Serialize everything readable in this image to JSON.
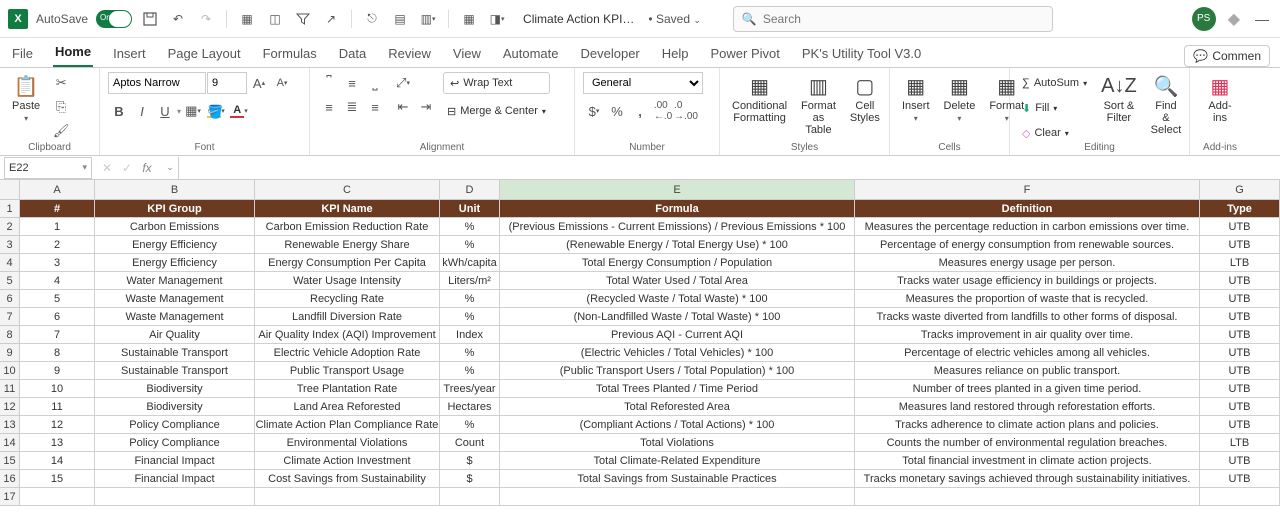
{
  "titlebar": {
    "autosave_label": "AutoSave",
    "autosave_on": "On",
    "filename": "Climate Action KPI…",
    "saved": "Saved",
    "search_placeholder": "Search",
    "avatar_initials": "PS"
  },
  "tabs": {
    "file": "File",
    "home": "Home",
    "insert": "Insert",
    "page_layout": "Page Layout",
    "formulas": "Formulas",
    "data": "Data",
    "review": "Review",
    "view": "View",
    "automate": "Automate",
    "developer": "Developer",
    "help": "Help",
    "power_pivot": "Power Pivot",
    "util": "PK's Utility Tool V3.0",
    "comments": "Commen"
  },
  "ribbon": {
    "clipboard": {
      "paste": "Paste",
      "label": "Clipboard"
    },
    "font": {
      "name": "Aptos Narrow",
      "size": "9",
      "label": "Font",
      "bold": "B",
      "italic": "I",
      "underline": "U",
      "font_letter": "A"
    },
    "alignment": {
      "wrap": "Wrap Text",
      "merge": "Merge & Center",
      "label": "Alignment"
    },
    "number": {
      "format": "General",
      "label": "Number"
    },
    "styles": {
      "cond": "Conditional Formatting",
      "fmt_table": "Format as Table",
      "cell_styles": "Cell Styles",
      "label": "Styles"
    },
    "cells": {
      "insert": "Insert",
      "delete": "Delete",
      "format": "Format",
      "label": "Cells"
    },
    "editing": {
      "autosum": "AutoSum",
      "fill": "Fill",
      "clear": "Clear",
      "sort": "Sort & Filter",
      "find": "Find & Select",
      "label": "Editing"
    },
    "addins": {
      "btn": "Add-ins",
      "label": "Add-ins"
    }
  },
  "formula_bar": {
    "name_box": "E22",
    "formula": ""
  },
  "columns": [
    "A",
    "B",
    "C",
    "D",
    "E",
    "F",
    "G"
  ],
  "header_row": [
    "#",
    "KPI Group",
    "KPI Name",
    "Unit",
    "Formula",
    "Definition",
    "Type"
  ],
  "rows": [
    [
      "1",
      "Carbon Emissions",
      "Carbon Emission Reduction Rate",
      "%",
      "(Previous Emissions - Current Emissions) / Previous Emissions * 100",
      "Measures the percentage reduction in carbon emissions over time.",
      "UTB"
    ],
    [
      "2",
      "Energy Efficiency",
      "Renewable Energy Share",
      "%",
      "(Renewable Energy / Total Energy Use) * 100",
      "Percentage of energy consumption from renewable sources.",
      "UTB"
    ],
    [
      "3",
      "Energy Efficiency",
      "Energy Consumption Per Capita",
      "kWh/capita",
      "Total Energy Consumption / Population",
      "Measures energy usage per person.",
      "LTB"
    ],
    [
      "4",
      "Water Management",
      "Water Usage Intensity",
      "Liters/m²",
      "Total Water Used / Total Area",
      "Tracks water usage efficiency in buildings or projects.",
      "UTB"
    ],
    [
      "5",
      "Waste Management",
      "Recycling Rate",
      "%",
      "(Recycled Waste / Total Waste) * 100",
      "Measures the proportion of waste that is recycled.",
      "UTB"
    ],
    [
      "6",
      "Waste Management",
      "Landfill Diversion Rate",
      "%",
      "(Non-Landfilled Waste / Total Waste) * 100",
      "Tracks waste diverted from landfills to other forms of disposal.",
      "UTB"
    ],
    [
      "7",
      "Air Quality",
      "Air Quality Index (AQI) Improvement",
      "Index",
      "Previous AQI - Current AQI",
      "Tracks improvement in air quality over time.",
      "UTB"
    ],
    [
      "8",
      "Sustainable Transport",
      "Electric Vehicle Adoption Rate",
      "%",
      "(Electric Vehicles / Total Vehicles) * 100",
      "Percentage of electric vehicles among all vehicles.",
      "UTB"
    ],
    [
      "9",
      "Sustainable Transport",
      "Public Transport Usage",
      "%",
      "(Public Transport Users / Total Population) * 100",
      "Measures reliance on public transport.",
      "UTB"
    ],
    [
      "10",
      "Biodiversity",
      "Tree Plantation Rate",
      "Trees/year",
      "Total Trees Planted / Time Period",
      "Number of trees planted in a given time period.",
      "UTB"
    ],
    [
      "11",
      "Biodiversity",
      "Land Area Reforested",
      "Hectares",
      "Total Reforested Area",
      "Measures land restored through reforestation efforts.",
      "UTB"
    ],
    [
      "12",
      "Policy Compliance",
      "Climate Action Plan Compliance Rate",
      "%",
      "(Compliant Actions / Total Actions) * 100",
      "Tracks adherence to climate action plans and policies.",
      "UTB"
    ],
    [
      "13",
      "Policy Compliance",
      "Environmental Violations",
      "Count",
      "Total Violations",
      "Counts the number of environmental regulation breaches.",
      "LTB"
    ],
    [
      "14",
      "Financial Impact",
      "Climate Action Investment",
      "$",
      "Total Climate-Related Expenditure",
      "Total financial investment in climate action projects.",
      "UTB"
    ],
    [
      "15",
      "Financial Impact",
      "Cost Savings from Sustainability",
      "$",
      "Total Savings from Sustainable Practices",
      "Tracks monetary savings achieved through sustainability initiatives.",
      "UTB"
    ]
  ],
  "row_numbers": [
    "1",
    "2",
    "3",
    "4",
    "5",
    "6",
    "7",
    "8",
    "9",
    "10",
    "11",
    "12",
    "13",
    "14",
    "15",
    "16",
    "17"
  ]
}
